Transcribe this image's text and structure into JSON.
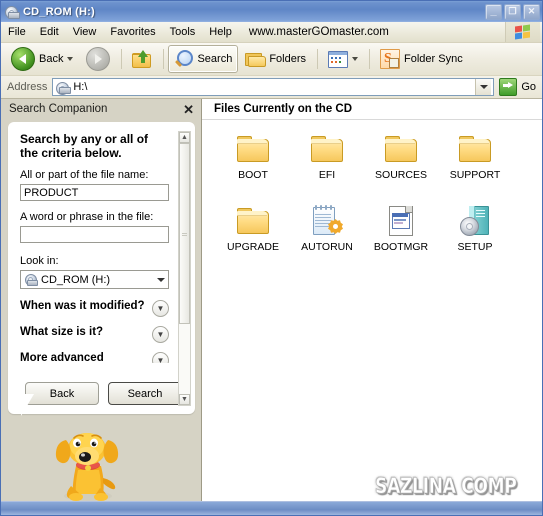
{
  "window": {
    "title": "CD_ROM (H:)",
    "title_icon": "cdrom-drive-icon",
    "buttons": {
      "minimize": "_",
      "maximize": "❐",
      "close": "✕"
    }
  },
  "menubar": {
    "items": [
      "File",
      "Edit",
      "View",
      "Favorites",
      "Tools",
      "Help"
    ],
    "url_text": "www.masterGOmaster.com",
    "brand_icon": "windows-flag-icon"
  },
  "toolbar": {
    "back_label": "Back",
    "forward_label": "",
    "up_label": "",
    "search_label": "Search",
    "folders_label": "Folders",
    "views_label": "",
    "foldersync_label": "Folder Sync"
  },
  "address": {
    "label": "Address",
    "value": "H:\\",
    "go_label": "Go",
    "icon": "cdrom-drive-icon"
  },
  "search_panel": {
    "title": "Search Companion",
    "close_label": "✕",
    "heading": "Search by any or all of the criteria below.",
    "filename_label": "All or part of the file name:",
    "filename_value": "PRODUCT",
    "phrase_label": "A word or phrase in the file:",
    "phrase_value": "",
    "lookin_label": "Look in:",
    "lookin_value": "CD_ROM (H:)",
    "option_modified": "When was it modified?",
    "option_size": "What size is it?",
    "option_advanced": "More advanced",
    "back_button": "Back",
    "search_button": "Search",
    "mascot": "dog-mascot-icon"
  },
  "files_panel": {
    "header": "Files Currently on the CD",
    "items": [
      {
        "name": "BOOT",
        "type": "folder"
      },
      {
        "name": "EFI",
        "type": "folder"
      },
      {
        "name": "SOURCES",
        "type": "folder"
      },
      {
        "name": "SUPPORT",
        "type": "folder"
      },
      {
        "name": "UPGRADE",
        "type": "folder"
      },
      {
        "name": "AUTORUN",
        "type": "autorun-inf"
      },
      {
        "name": "BOOTMGR",
        "type": "system-file"
      },
      {
        "name": "SETUP",
        "type": "application"
      }
    ]
  },
  "watermark": {
    "text": "SAZLINA COMP"
  },
  "colors": {
    "titlebar_blue": "#5f86c6",
    "chrome_tan": "#ece9d8",
    "folder_yellow": "#f6c75c",
    "accent_green": "#3f9c2a",
    "panel_grey": "#d6d3c5"
  }
}
